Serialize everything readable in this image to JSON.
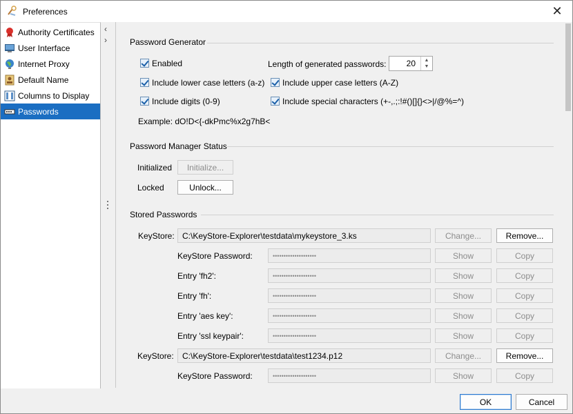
{
  "window": {
    "title": "Preferences"
  },
  "sidebar": {
    "items": [
      {
        "label": "Authority Certificates",
        "icon": "certificate-ribbon-icon",
        "selected": false
      },
      {
        "label": "User Interface",
        "icon": "monitor-icon",
        "selected": false
      },
      {
        "label": "Internet Proxy",
        "icon": "globe-icon",
        "selected": false
      },
      {
        "label": "Default Name",
        "icon": "id-card-icon",
        "selected": false
      },
      {
        "label": "Columns to Display",
        "icon": "columns-icon",
        "selected": false
      },
      {
        "label": "Passwords",
        "icon": "password-field-icon",
        "selected": true
      }
    ]
  },
  "password_generator": {
    "title": "Password Generator",
    "enabled_label": "Enabled",
    "enabled_checked": true,
    "length_label": "Length of generated passwords:",
    "length_value": "20",
    "lower_label": "Include lower case letters (a-z)",
    "lower_checked": true,
    "upper_label": "Include upper case letters (A-Z)",
    "upper_checked": true,
    "digits_label": "Include digits (0-9)",
    "digits_checked": true,
    "special_label": "Include special characters (+-,.;:!#()[]{}<>|/@%=^)",
    "special_checked": true,
    "example": "Example: dO!D<{-dkPmc%x2g7hB<"
  },
  "manager_status": {
    "title": "Password Manager Status",
    "initialized_label": "Initialized",
    "initialize_button": "Initialize...",
    "locked_label": "Locked",
    "unlock_button": "Unlock..."
  },
  "stored": {
    "title": "Stored Passwords",
    "keystores": [
      {
        "label": "KeyStore:",
        "path": "C:\\KeyStore-Explorer\\testdata\\mykeystore_3.ks",
        "change_button": "Change...",
        "remove_button": "Remove...",
        "entries": [
          {
            "label": "KeyStore Password:",
            "mask": "••••••••••••••••••••",
            "show": "Show",
            "copy": "Copy"
          },
          {
            "label": "Entry 'fh2':",
            "mask": "••••••••••••••••••••",
            "show": "Show",
            "copy": "Copy"
          },
          {
            "label": "Entry 'fh':",
            "mask": "••••••••••••••••••••",
            "show": "Show",
            "copy": "Copy"
          },
          {
            "label": "Entry 'aes key':",
            "mask": "••••••••••••••••••••",
            "show": "Show",
            "copy": "Copy"
          },
          {
            "label": "Entry 'ssl keypair':",
            "mask": "••••••••••••••••••••",
            "show": "Show",
            "copy": "Copy"
          }
        ]
      },
      {
        "label": "KeyStore:",
        "path": "C:\\KeyStore-Explorer\\testdata\\test1234.p12",
        "change_button": "Change...",
        "remove_button": "Remove...",
        "entries": [
          {
            "label": "KeyStore Password:",
            "mask": "••••••••••••••••••••",
            "show": "Show",
            "copy": "Copy"
          }
        ]
      }
    ]
  },
  "footer": {
    "ok": "OK",
    "cancel": "Cancel"
  },
  "colors": {
    "selection": "#1b6ec2",
    "accent": "#2b79d0"
  }
}
